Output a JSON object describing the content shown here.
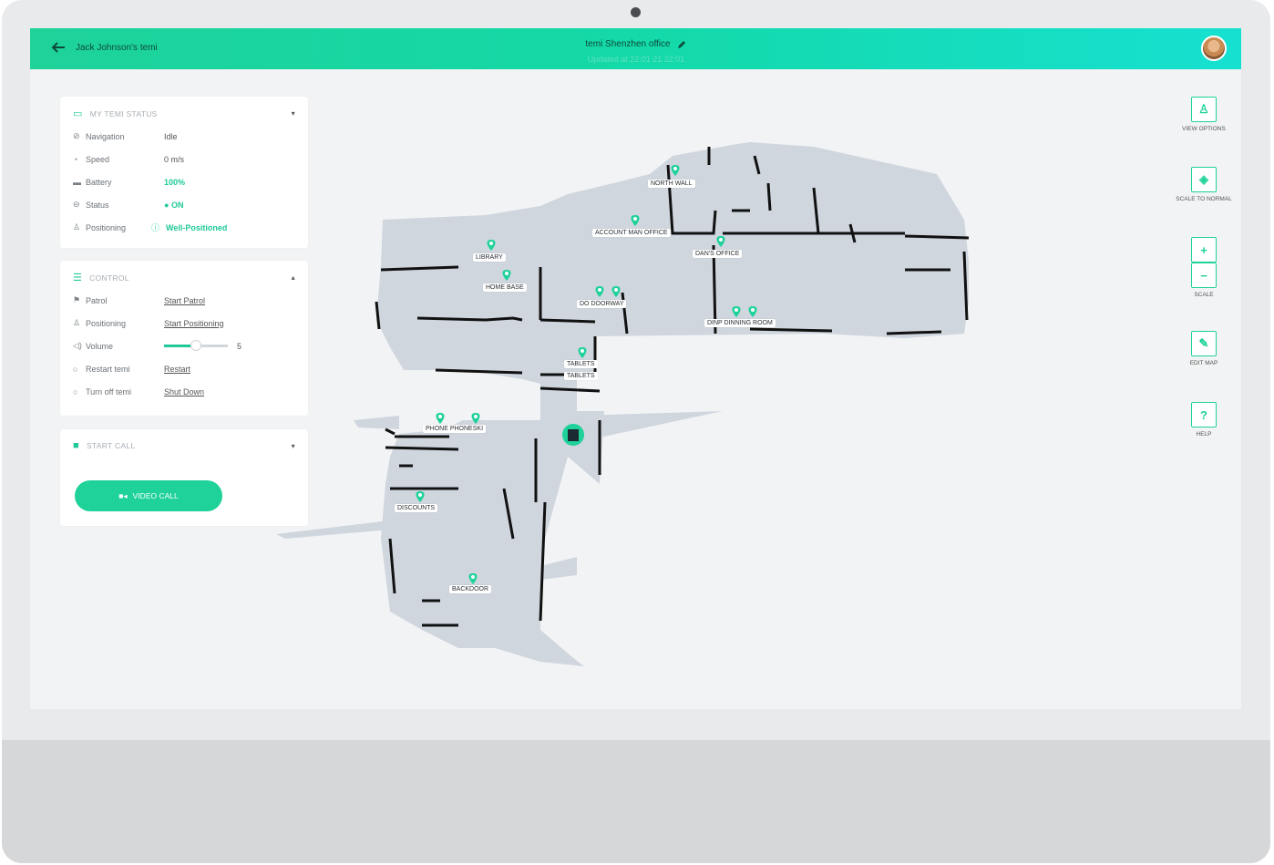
{
  "header": {
    "back_label": "Jack Johnson's temi",
    "title": "temi Shenzhen office",
    "subtitle": "Updated at 22:01 21 22:01"
  },
  "status_panel": {
    "title": "MY TEMI STATUS",
    "rows": [
      {
        "label": "Navigation",
        "value": "Idle",
        "icon": "navigation-icon"
      },
      {
        "label": "Speed",
        "value": "0 m/s",
        "icon": "speed-icon"
      },
      {
        "label": "Battery",
        "value": "100%",
        "icon": "battery-icon"
      },
      {
        "label": "Status",
        "value": "ON",
        "icon": "status-icon"
      },
      {
        "label": "Positioning",
        "value": "Well-Positioned",
        "icon": "positioning-icon"
      }
    ]
  },
  "control_panel": {
    "title": "CONTROL",
    "rows": [
      {
        "label": "Patrol",
        "value": "Start Patrol"
      },
      {
        "label": "Positioning",
        "value": "Start Positioning"
      },
      {
        "label": "Volume",
        "value": "5"
      },
      {
        "label": "Restart temi",
        "value": "Restart"
      },
      {
        "label": "Turn off temi",
        "value": "Shut Down"
      }
    ],
    "volume_fraction": 0.5
  },
  "call_panel": {
    "title": "START CALL",
    "button": "VIDEO CALL"
  },
  "map_labels": {
    "north_wall": "NORTH WALL",
    "account_man_office": "ACCOUNT MAN OFFICE",
    "dans_office": "DAN'S OFFICE",
    "library": "LIBRARY",
    "home_base": "HOME BASE",
    "do_doorway": "DO  DOORWAY",
    "dinp_dining_room": "DINP  DINNING ROOM",
    "tablets_1": "TABLETS",
    "tablets_2": "TABLETS",
    "phone": "PHONE  PHONESKI",
    "discounts": "DISCOUNTS",
    "backdoor": "BACKDOOR"
  },
  "tools": {
    "view_options": "VIEW OPTIONS",
    "scale_to_normal": "SCALE TO NORMAL",
    "scale": "SCALE",
    "edit_map": "EDIT MAP",
    "help": "HELP"
  },
  "colors": {
    "accent": "#1ed29a",
    "map_floor": "#cfd6de",
    "wall": "#111111"
  }
}
